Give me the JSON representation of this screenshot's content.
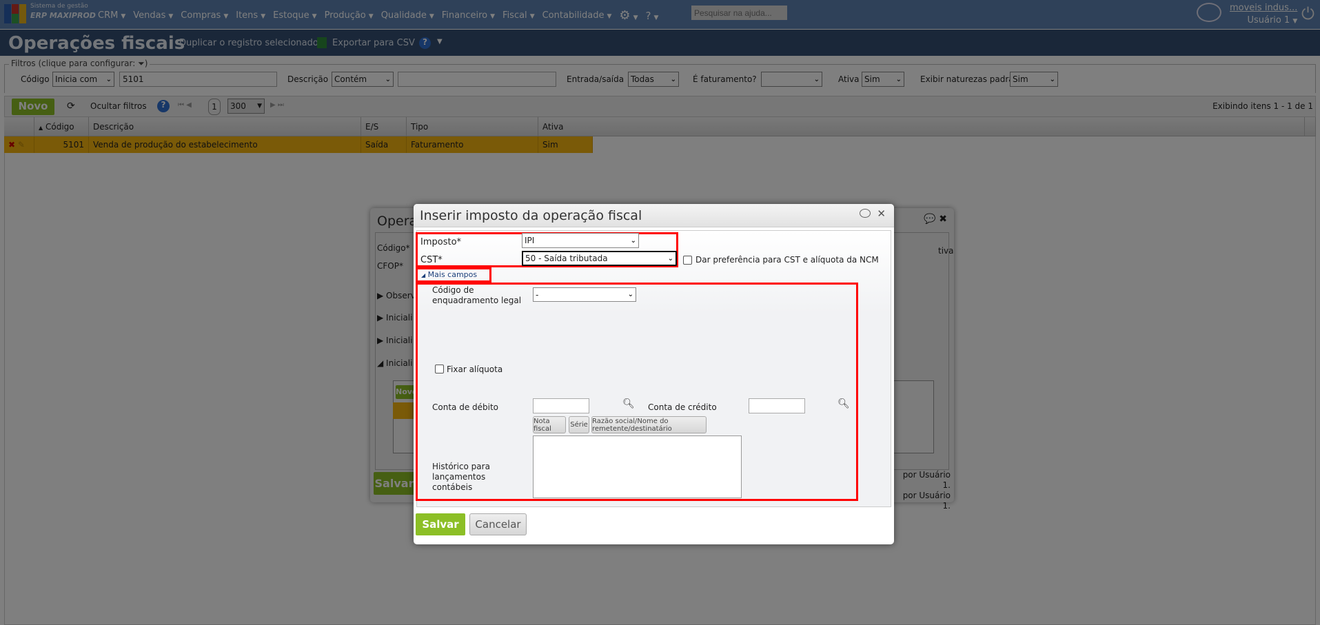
{
  "nav": {
    "brand_line1": "Sistema de gestão",
    "brand_line2": "ERP MAXIPROD",
    "menu": [
      "CRM",
      "Vendas",
      "Compras",
      "Itens",
      "Estoque",
      "Produção",
      "Qualidade",
      "Financeiro",
      "Fiscal",
      "Contabilidade"
    ],
    "search_placeholder": "Pesquisar na ajuda...",
    "company": "moveis indus...",
    "user": "Usuário 1"
  },
  "header": {
    "title": "Operações fiscais",
    "duplicate": "Duplicar o registro selecionado",
    "export": "Exportar para CSV"
  },
  "filters": {
    "legend": "Filtros (clique para configurar:",
    "codigo_label": "Código",
    "codigo_op": "Inicia com",
    "codigo_value": "5101",
    "descricao_label": "Descrição",
    "descricao_op": "Contém",
    "descricao_value": "",
    "es_label": "Entrada/saída",
    "es_value": "Todas",
    "fat_label": "É faturamento?",
    "fat_value": "",
    "ativa_label": "Ativa",
    "ativa_value": "Sim",
    "padrao_label": "Exibir naturezas padrão",
    "padrao_value": "Sim"
  },
  "toolbar": {
    "new": "Novo",
    "hide_filters": "Ocultar filtros",
    "page": "1",
    "page_size": "300",
    "summary": "Exibindo itens 1 - 1 de 1"
  },
  "grid": {
    "columns": [
      "Código",
      "Descrição",
      "E/S",
      "Tipo",
      "Ativa"
    ],
    "rows": [
      {
        "codigo": "5101",
        "descricao": "Venda de produção do estabelecimento",
        "es": "Saída",
        "tipo": "Faturamento",
        "ativa": "Sim"
      }
    ]
  },
  "bg_dialog": {
    "title": "Opera",
    "codigo": "Código*",
    "cfop": "CFOP*",
    "sec1": "Observ",
    "sec2": "Iniciali",
    "sec3": "Iniciali",
    "sec4": "Iniciali",
    "novo": "Novo",
    "salvar": "Salvar",
    "ativa": "tiva",
    "audit1": "por Usuário 1.",
    "audit2": "por Usuário 1."
  },
  "dialog": {
    "title": "Inserir imposto da operação fiscal",
    "imposto_label": "Imposto*",
    "imposto_value": "IPI",
    "cst_label": "CST*",
    "cst_value": "50 - Saída tributada",
    "ncm_pref": "Dar preferência para CST e alíquota da NCM",
    "more_fields": "Mais campos",
    "enq_label": "Código de enquadramento legal",
    "enq_value": "-",
    "fixar": "Fixar alíquota",
    "debito": "Conta de débito",
    "credito": "Conta de crédito",
    "tag_nf": "Nota fiscal",
    "tag_serie": "Série",
    "tag_razao": "Razão social/Nome do remetente/destinatário",
    "historico": "Histórico para lançamentos contábeis",
    "save": "Salvar",
    "cancel": "Cancelar"
  }
}
